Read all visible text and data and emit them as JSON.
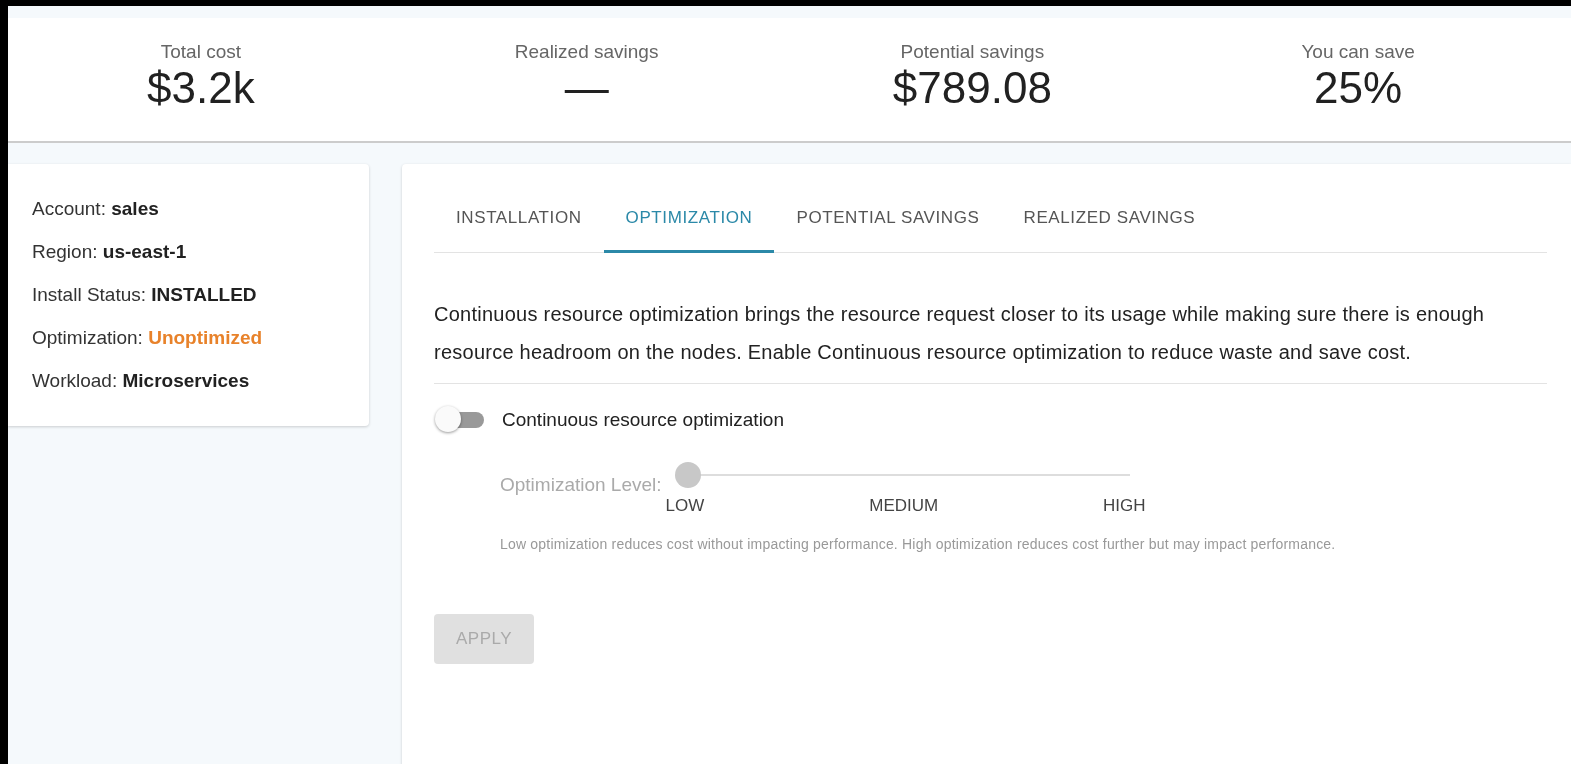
{
  "stats": [
    {
      "label": "Total cost",
      "value": "$3.2k"
    },
    {
      "label": "Realized savings",
      "value": "—"
    },
    {
      "label": "Potential savings",
      "value": "$789.08"
    },
    {
      "label": "You can save",
      "value": "25%"
    }
  ],
  "info": [
    {
      "label": "Account:",
      "value": "sales",
      "color": "#212121"
    },
    {
      "label": "Region:",
      "value": "us-east-1",
      "color": "#212121"
    },
    {
      "label": "Install Status:",
      "value": "INSTALLED",
      "color": "#212121"
    },
    {
      "label": "Optimization:",
      "value": "Unoptimized",
      "color": "#e8822a"
    },
    {
      "label": "Workload:",
      "value": "Microservices",
      "color": "#212121"
    }
  ],
  "tabs": [
    {
      "label": "INSTALLATION",
      "selected": false
    },
    {
      "label": "OPTIMIZATION",
      "selected": true
    },
    {
      "label": "POTENTIAL SAVINGS",
      "selected": false
    },
    {
      "label": "REALIZED SAVINGS",
      "selected": false
    }
  ],
  "description": "Continuous resource optimization brings the resource request closer to its usage while making sure there is enough resource headroom on the nodes. Enable Continuous resource optimization to reduce waste and save cost.",
  "toggle": {
    "label": "Continuous resource optimization",
    "on": false
  },
  "slider": {
    "label": "Optimization Level:",
    "level": 0,
    "marks": [
      "LOW",
      "MEDIUM",
      "HIGH"
    ],
    "hint": "Low optimization reduces cost without impacting performance. High optimization reduces cost further but may impact performance."
  },
  "apply_button": {
    "label": "APPLY",
    "disabled": true
  }
}
